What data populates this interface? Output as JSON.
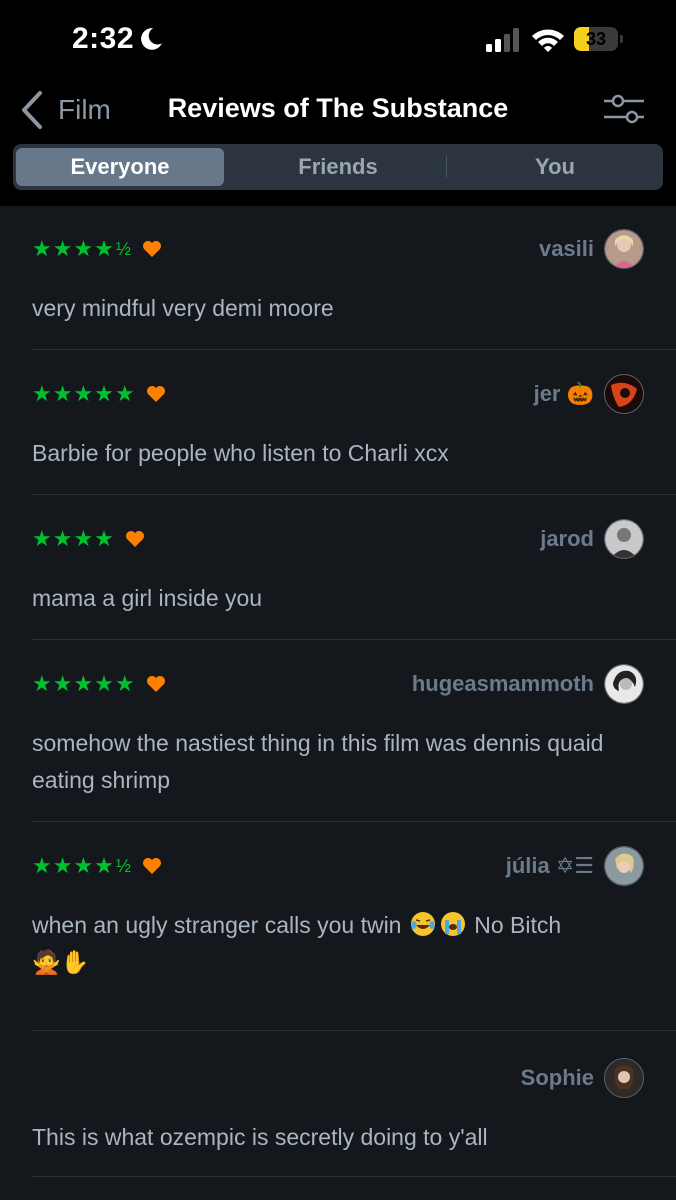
{
  "status_bar": {
    "time": "2:32",
    "battery": "33",
    "battery_level": 0.33
  },
  "header": {
    "back_label": "Film",
    "title": "Reviews of The Substance"
  },
  "tabs": [
    {
      "label": "Everyone",
      "active": true
    },
    {
      "label": "Friends",
      "active": false
    },
    {
      "label": "You",
      "active": false
    }
  ],
  "reviews": [
    {
      "stars": "★★★★",
      "half": "½",
      "liked": true,
      "user": "vasili",
      "text": "very mindful very demi moore"
    },
    {
      "stars": "★★★★★",
      "half": "",
      "liked": true,
      "user": "jer 🎃",
      "text": "Barbie for people who listen to Charli xcx"
    },
    {
      "stars": "★★★★",
      "half": "",
      "liked": true,
      "user": "jarod",
      "text": "mama a girl inside you"
    },
    {
      "stars": "★★★★★",
      "half": "",
      "liked": true,
      "user": "hugeasmammoth",
      "text": "somehow the nastiest thing in this film was dennis quaid eating shrimp"
    },
    {
      "stars": "★★★★",
      "half": "½",
      "liked": true,
      "user": "júlia ✡☰",
      "text_part1": "when an ugly stranger calls you twin",
      "text_part2": " No Bitch",
      "text_part3": "🙅✋"
    },
    {
      "stars": "",
      "half": "",
      "liked": false,
      "user": "Sophie",
      "text": "This is what ozempic is secretly doing to y'all"
    }
  ],
  "colors": {
    "star_green": "#00c030",
    "heart_orange": "#ff8000",
    "background": "#14181c"
  }
}
